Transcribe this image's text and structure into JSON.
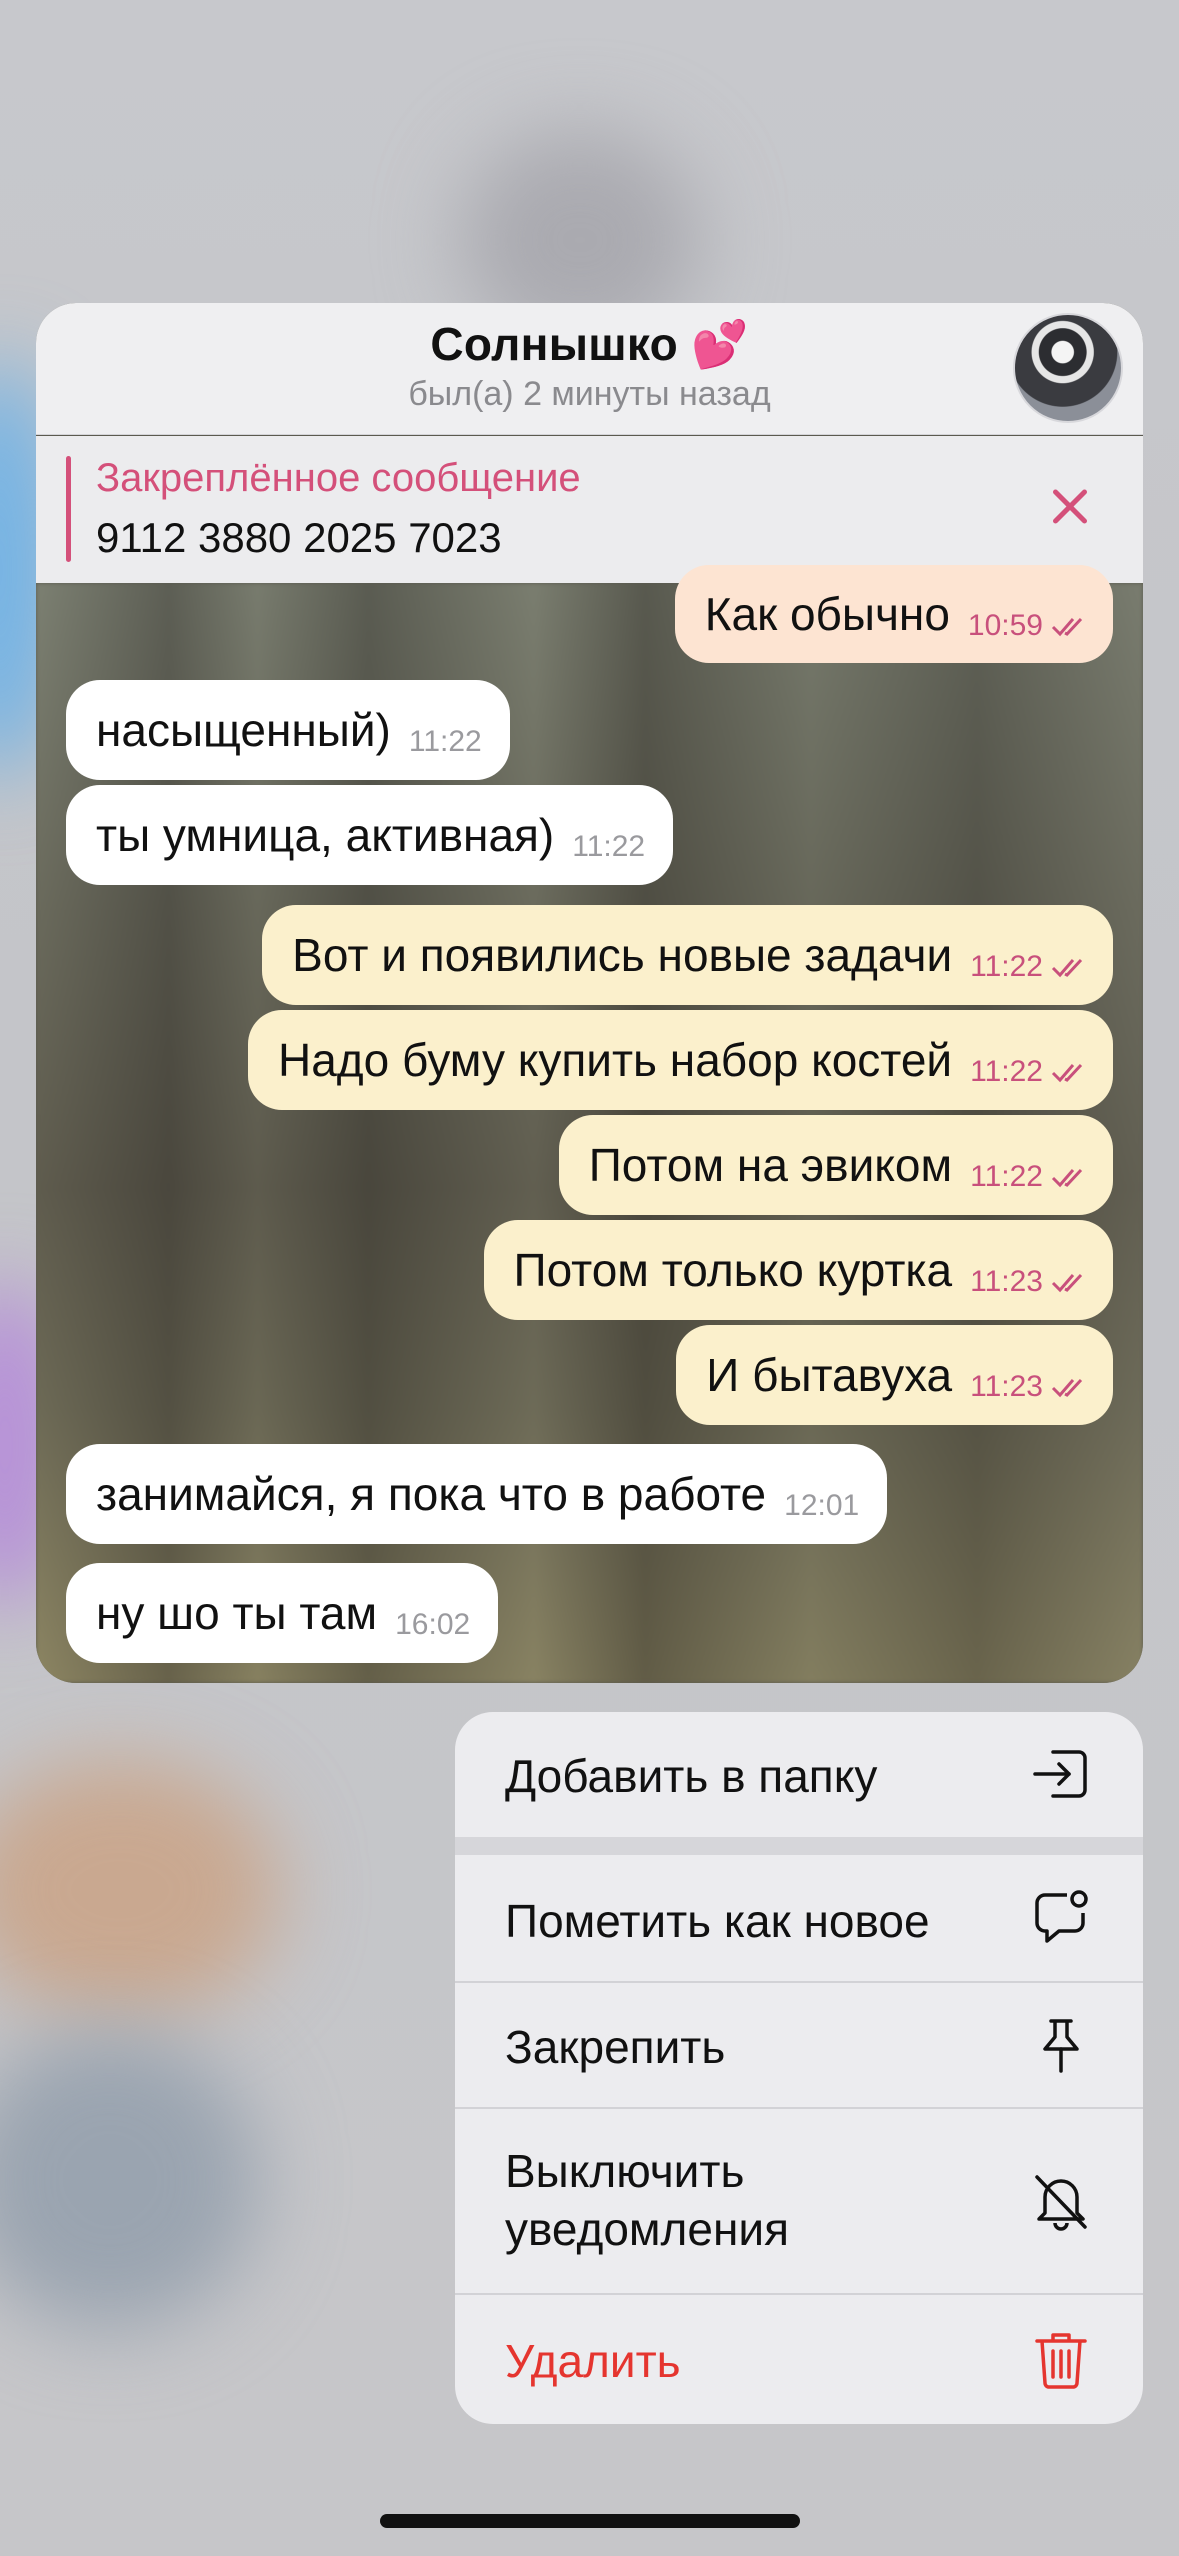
{
  "chat": {
    "title": "Солнышко 💕",
    "status": "был(а) 2 минуты назад",
    "avatar_icon": "robot-avatar-icon",
    "pinned": {
      "title": "Закреплённое сообщение",
      "text": "9112 3880 2025 7023"
    }
  },
  "messages": [
    {
      "direction": "out",
      "text": "Как обычно",
      "time": "10:59",
      "read": true
    },
    {
      "direction": "in",
      "text": "насыщенный)",
      "time": "11:22"
    },
    {
      "direction": "in",
      "text": "ты умница, активная)",
      "time": "11:22"
    },
    {
      "direction": "out",
      "text": "Вот и появились новые задачи",
      "time": "11:22",
      "read": true
    },
    {
      "direction": "out",
      "text": "Надо буму купить набор костей",
      "time": "11:22",
      "read": true
    },
    {
      "direction": "out",
      "text": "Потом на эвиком",
      "time": "11:22",
      "read": true
    },
    {
      "direction": "out",
      "text": "Потом только куртка",
      "time": "11:23",
      "read": true
    },
    {
      "direction": "out",
      "text": "И бытавуха",
      "time": "11:23",
      "read": true
    },
    {
      "direction": "in",
      "text": "занимайся, я пока что в работе",
      "time": "12:01"
    },
    {
      "direction": "in",
      "text": "ну шо ты там",
      "time": "16:02"
    }
  ],
  "menu": {
    "items": [
      {
        "label": "Добавить в папку",
        "icon": "add-to-folder-icon"
      },
      {
        "label": "Пометить как новое",
        "icon": "mark-unread-icon"
      },
      {
        "label": "Закрепить",
        "icon": "pin-icon"
      },
      {
        "label": "Выключить уведомления",
        "icon": "mute-bell-icon"
      },
      {
        "label": "Удалить",
        "icon": "trash-icon",
        "color": "#e5352f"
      }
    ]
  },
  "colors": {
    "accent": "#d4507a",
    "outgoing_bubble": "#fbf0cc",
    "incoming_bubble": "#ffffff",
    "danger": "#e5352f"
  }
}
